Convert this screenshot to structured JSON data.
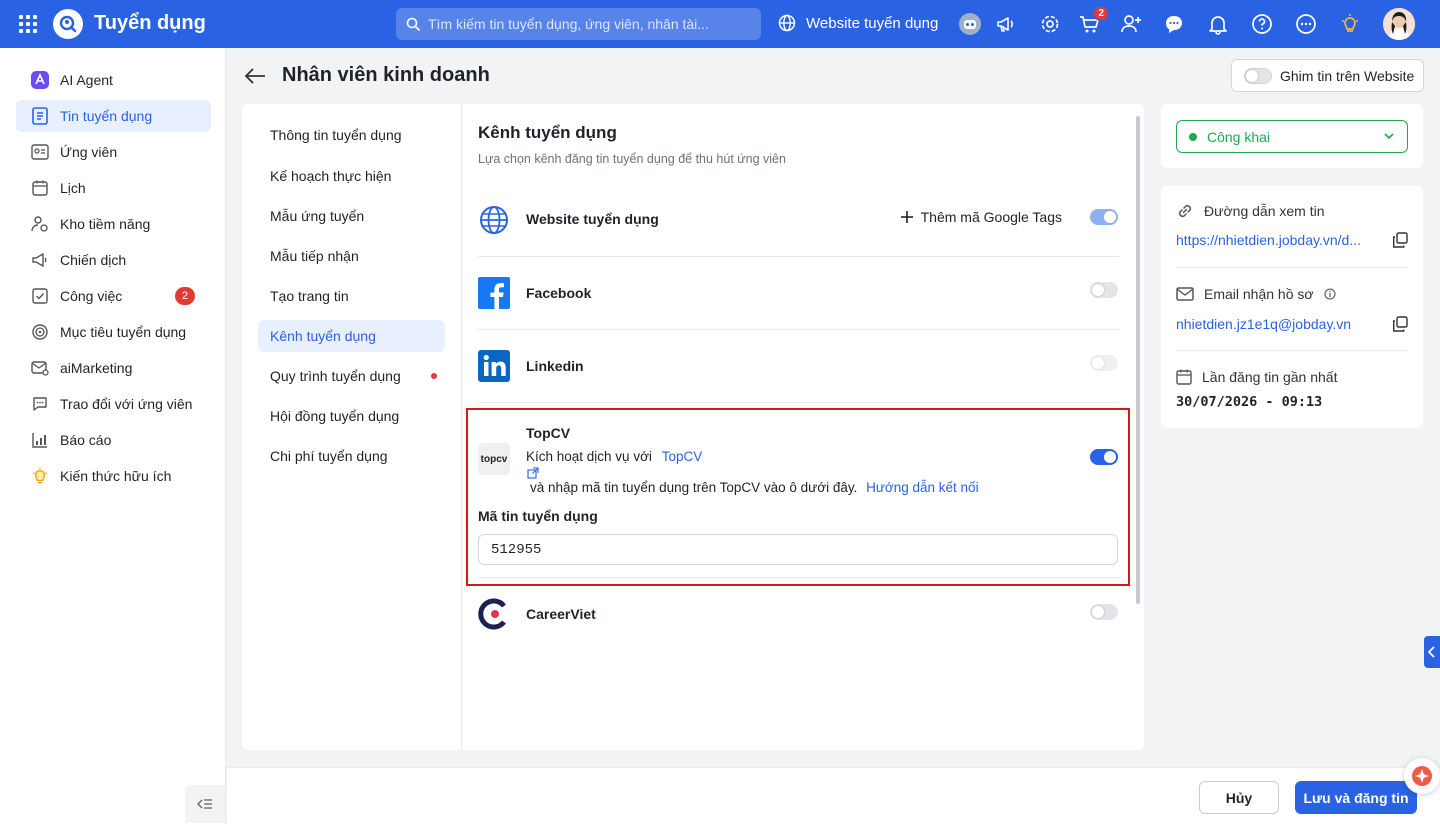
{
  "topbar": {
    "app_title": "Tuyển dụng",
    "search_placeholder": "Tìm kiếm tin tuyển dụng, ứng viên, nhân tài...",
    "website_link": "Website tuyển dụng",
    "cart_badge": "2",
    "brand_color": "#2a62e4"
  },
  "sidebar": {
    "items": [
      {
        "label": "AI Agent",
        "icon": "ai-agent-icon"
      },
      {
        "label": "Tin tuyển dụng",
        "icon": "job-post-icon"
      },
      {
        "label": "Ứng viên",
        "icon": "candidate-icon"
      },
      {
        "label": "Lịch",
        "icon": "calendar-icon"
      },
      {
        "label": "Kho tiềm năng",
        "icon": "talent-pool-icon"
      },
      {
        "label": "Chiến dịch",
        "icon": "megaphone-icon"
      },
      {
        "label": "Công việc",
        "icon": "task-icon",
        "badge": "2"
      },
      {
        "label": "Mục tiêu tuyển dụng",
        "icon": "target-icon"
      },
      {
        "label": "aiMarketing",
        "icon": "mail-settings-icon"
      },
      {
        "label": "Trao đổi với ứng viên",
        "icon": "chat-icon"
      },
      {
        "label": "Báo cáo",
        "icon": "report-icon"
      },
      {
        "label": "Kiến thức hữu ích",
        "icon": "lightbulb-icon"
      }
    ]
  },
  "header": {
    "title": "Nhân viên kinh doanh",
    "pin_label": "Ghim tin trên Website"
  },
  "left_menu": {
    "items": [
      {
        "label": "Thông tin tuyển dụng"
      },
      {
        "label": "Kế hoạch thực hiện"
      },
      {
        "label": "Mẫu ứng tuyển"
      },
      {
        "label": "Mẫu tiếp nhận"
      },
      {
        "label": "Tạo trang tin"
      },
      {
        "label": "Kênh tuyển dụng"
      },
      {
        "label": "Quy trình tuyển dụng"
      },
      {
        "label": "Hội đồng tuyển dụng"
      },
      {
        "label": "Chi phí tuyển dụng"
      }
    ]
  },
  "channels": {
    "title": "Kênh tuyển dụng",
    "subtitle": "Lựa chọn kênh đăng tin tuyển dụng để thu hút ứng viên",
    "website": {
      "name": "Website tuyển dụng",
      "add_tag_label": "Thêm mã Google Tags",
      "enabled": true
    },
    "facebook": {
      "name": "Facebook",
      "enabled": false
    },
    "linkedin": {
      "name": "Linkedin",
      "enabled": false
    },
    "topcv": {
      "name": "TopCV",
      "logo_text": "topcv",
      "desc_prefix": "Kích hoạt dịch vụ với",
      "desc_link": "TopCV",
      "desc_suffix": "và nhập mã tin tuyển dụng trên TopCV vào ô dưới đây.",
      "guide_link": "Hướng dẫn kết nối",
      "field_label": "Mã tin tuyển dụng",
      "field_value": "512955",
      "enabled": true
    },
    "careerviet": {
      "name": "CareerViet",
      "enabled": false
    }
  },
  "right_panel": {
    "status": "Công khai",
    "status_color": "#1faa4a",
    "view_link_label": "Đường dẫn xem tin",
    "view_link": "https://nhietdien.jobday.vn/d...",
    "email_label": "Email nhận hồ sơ",
    "email": "nhietdien.jz1e1q@jobday.vn",
    "last_post_label": "Lần đăng tin gần nhất",
    "last_post": "30/07/2026 - 09:13"
  },
  "footer": {
    "cancel": "Hủy",
    "save": "Lưu và đăng tin"
  }
}
